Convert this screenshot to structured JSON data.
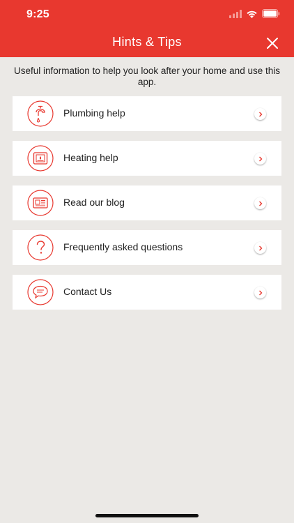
{
  "status_bar": {
    "time": "9:25"
  },
  "nav": {
    "title": "Hints & Tips"
  },
  "intro": "Useful information to help you look after your home and use this app.",
  "items": [
    {
      "label": "Plumbing help",
      "icon": "tap-icon"
    },
    {
      "label": "Heating help",
      "icon": "boiler-icon"
    },
    {
      "label": "Read our blog",
      "icon": "newspaper-icon"
    },
    {
      "label": "Frequently asked questions",
      "icon": "question-icon"
    },
    {
      "label": "Contact Us",
      "icon": "chat-bubble-icon"
    }
  ],
  "colors": {
    "brand": "#e8382f",
    "background": "#ebe9e6",
    "card": "#ffffff"
  }
}
